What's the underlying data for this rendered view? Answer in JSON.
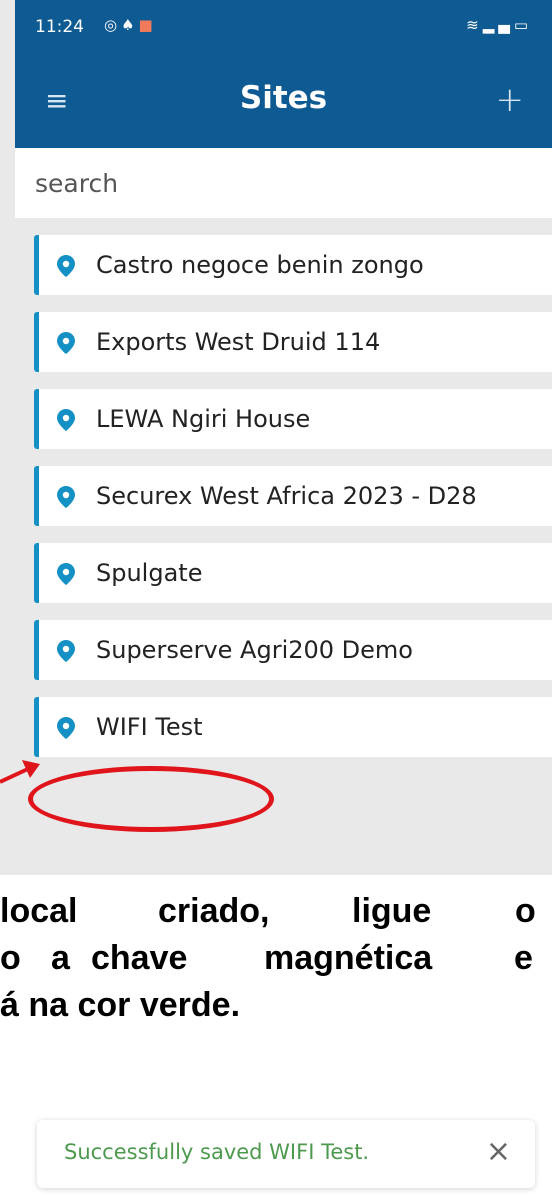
{
  "status_bar": {
    "time": "11:24",
    "left_icons": [
      "whatsapp-icon",
      "bell-icon",
      "shield-icon"
    ],
    "right_icons": [
      "wifi-icon",
      "signal-icon",
      "battery-icon"
    ]
  },
  "header": {
    "menu_icon": "≡",
    "title": "Sites",
    "add_icon": "+"
  },
  "search": {
    "placeholder": "search",
    "value": ""
  },
  "sites": [
    {
      "label": "Castro negoce benin zongo"
    },
    {
      "label": "Exports West Druid 114"
    },
    {
      "label": "LEWA Ngiri House"
    },
    {
      "label": "Securex West Africa 2023 - D28"
    },
    {
      "label": "Spulgate"
    },
    {
      "label": "Superserve Agri200 Demo"
    },
    {
      "label": "WIFI Test"
    }
  ],
  "caption": {
    "line1": [
      "local",
      "criado,",
      "ligue",
      "o"
    ],
    "line2": [
      "o",
      "a",
      "chave",
      "magnética",
      "e"
    ],
    "line3": "á na cor verde."
  },
  "toast": {
    "message": "Successfully saved WIFI Test.",
    "close": "×"
  },
  "colors": {
    "header_bg": "#0e5a93",
    "item_accent": "#1590c4",
    "annotation": "#e0151c",
    "toast_text": "#4d9a4e"
  }
}
